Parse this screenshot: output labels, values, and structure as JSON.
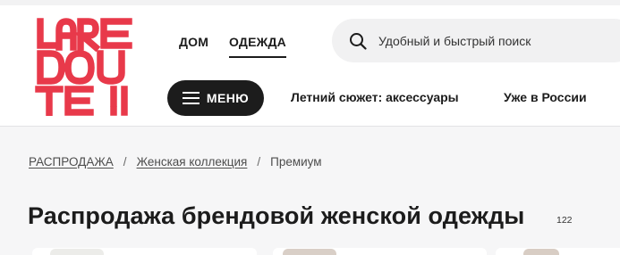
{
  "brand": {
    "logo_text": "LAREDOUTE",
    "logo_lines": [
      "LARE",
      "DOU",
      "TE!"
    ],
    "color": "#e8394a"
  },
  "nav": {
    "items": [
      {
        "label": "ДОМ",
        "active": false
      },
      {
        "label": "ОДЕЖДА",
        "active": true
      }
    ]
  },
  "search": {
    "placeholder": "Удобный и быстрый поиск",
    "icon": "search-icon"
  },
  "menu_button": {
    "label": "МЕНЮ",
    "icon": "hamburger-icon"
  },
  "promo_links": [
    {
      "label": "Летний сюжет: аксессуары"
    },
    {
      "label": "Уже в России"
    }
  ],
  "breadcrumb": {
    "items": [
      {
        "label": "РАСПРОДАЖА",
        "link": true
      },
      {
        "label": "Женская коллекция",
        "link": true
      },
      {
        "label": "Премиум",
        "link": false
      }
    ],
    "separator": "/"
  },
  "page": {
    "title": "Распродажа брендовой женской одежды",
    "count": "122"
  },
  "colors": {
    "accent": "#1c1c1c",
    "background": "#f6f6f7",
    "search_bg": "#f1f1f2"
  }
}
